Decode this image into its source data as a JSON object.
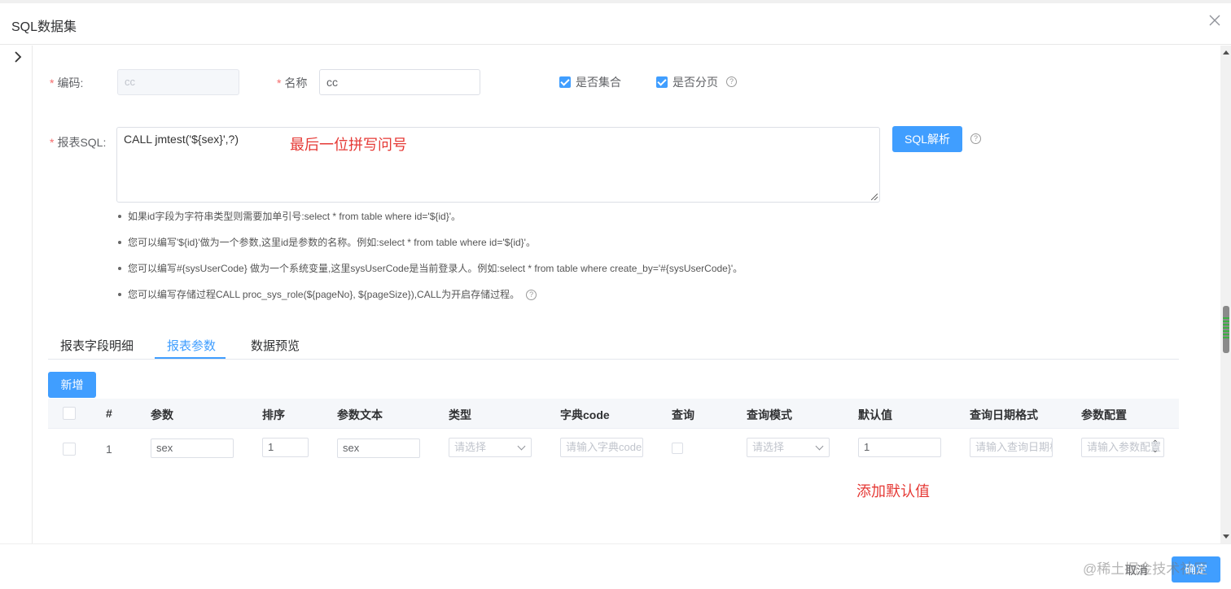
{
  "dialog": {
    "title": "SQL数据集",
    "close_icon": "close-icon"
  },
  "form": {
    "code_label": "编码:",
    "code_value": "cc",
    "name_label": "名称",
    "name_value": "cc",
    "is_collection_label": "是否集合",
    "is_paged_label": "是否分页",
    "sql_label": "报表SQL:",
    "sql_value": "CALL jmtest('${sex}',?)",
    "sql_annotation": "最后一位拼写问号",
    "sql_parse_button": "SQL解析"
  },
  "tips": [
    "如果id字段为字符串类型则需要加单引号:select * from table where id='${id}'。",
    "您可以编写'${id}'做为一个参数,这里id是参数的名称。例如:select * from table where id='${id}'。",
    "您可以编写#{sysUserCode} 做为一个系统变量,这里sysUserCode是当前登录人。例如:select * from table where create_by='#{sysUserCode}'。",
    "您可以编写存储过程CALL proc_sys_role(${pageNo}, ${pageSize}),CALL为开启存储过程。"
  ],
  "tabs": [
    {
      "label": "报表字段明细",
      "active": false
    },
    {
      "label": "报表参数",
      "active": true
    },
    {
      "label": "数据预览",
      "active": false
    }
  ],
  "add_button": "新增",
  "table": {
    "columns": [
      "#",
      "参数",
      "排序",
      "参数文本",
      "类型",
      "字典code",
      "查询",
      "查询模式",
      "默认值",
      "查询日期格式",
      "参数配置"
    ],
    "rows": [
      {
        "index": "1",
        "param": "sex",
        "order": "1",
        "param_text": "sex",
        "type_placeholder": "请选择",
        "dict_placeholder": "请输入字典code",
        "query_mode_placeholder": "请选择",
        "default_value": "1",
        "date_format_placeholder": "请输入查询日期格式",
        "config_placeholder": "请输入参数配置"
      }
    ],
    "default_annotation": "添加默认值"
  },
  "footer": {
    "cancel": "取消",
    "ok": "确定",
    "watermark": "@稀土掘金技术社区"
  },
  "colors": {
    "primary": "#409eff",
    "required": "#f56c6c",
    "annotation": "#e53935"
  }
}
